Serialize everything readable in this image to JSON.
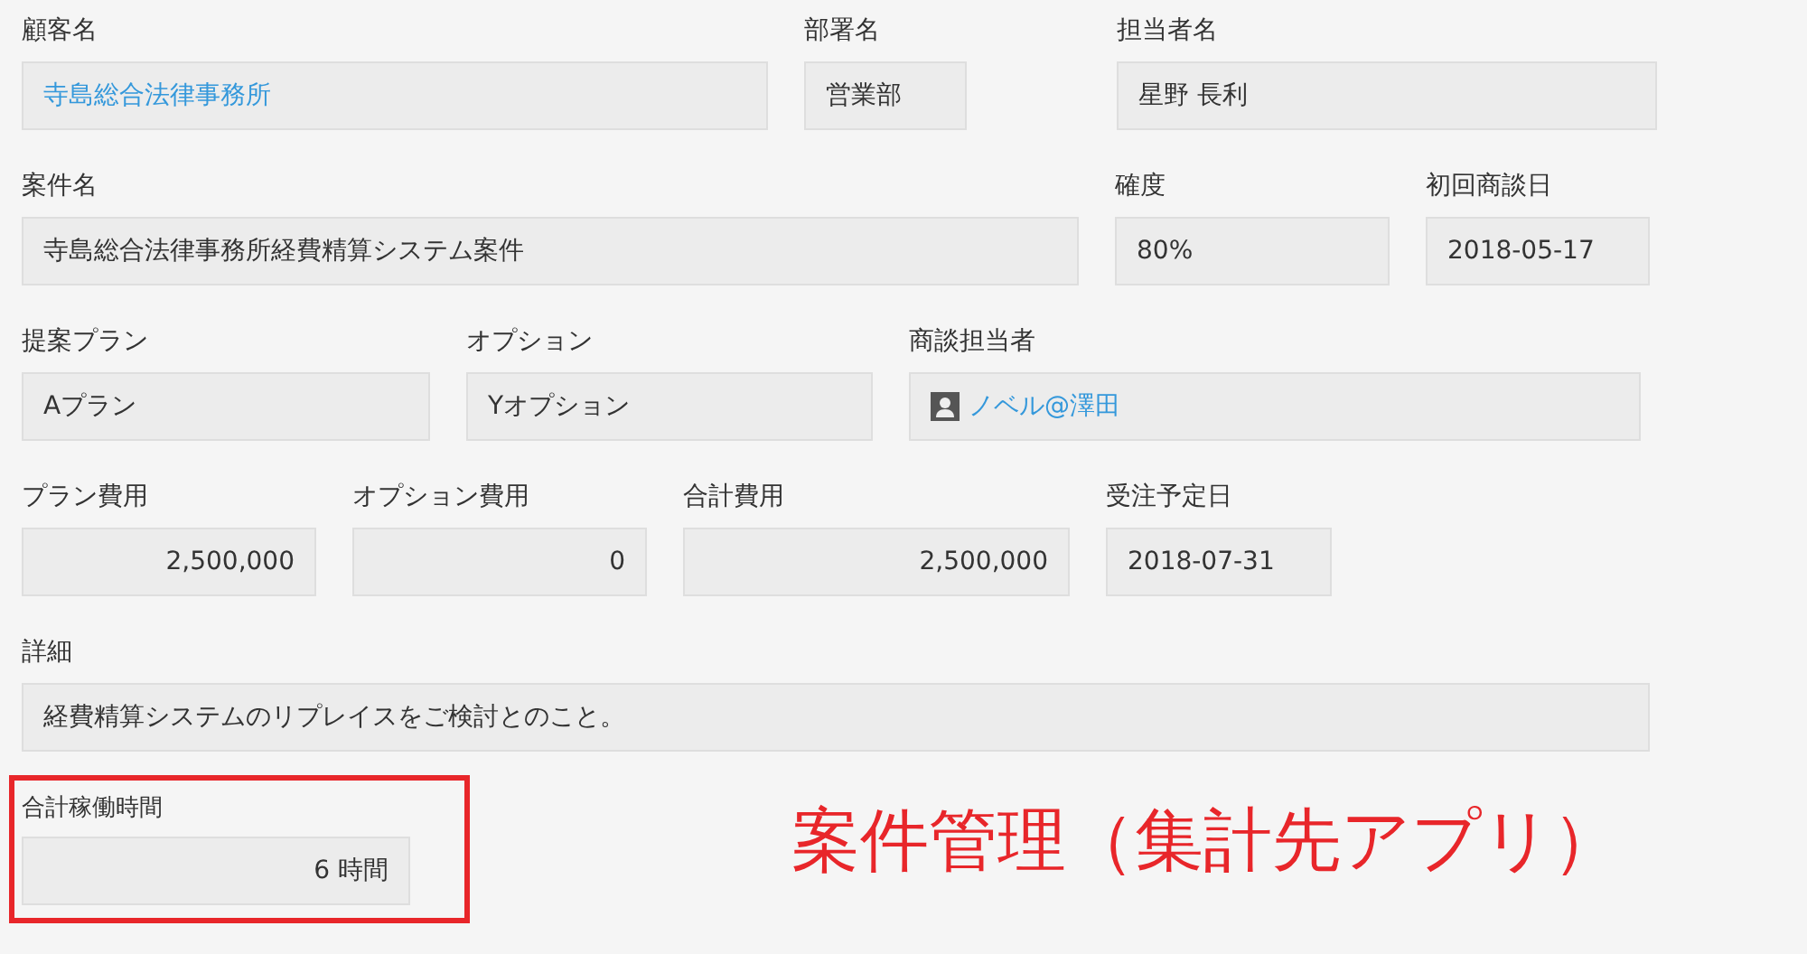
{
  "rows": [
    {
      "fields": [
        {
          "label": "顧客名",
          "value": "寺島総合法律事務所",
          "kind": "link"
        },
        {
          "label": "部署名",
          "value": "営業部",
          "kind": "text"
        },
        {
          "label": "担当者名",
          "value": "星野 長利",
          "kind": "text"
        }
      ]
    },
    {
      "fields": [
        {
          "label": "案件名",
          "value": "寺島総合法律事務所経費精算システム案件",
          "kind": "text"
        },
        {
          "label": "確度",
          "value": "80%",
          "kind": "text"
        },
        {
          "label": "初回商談日",
          "value": "2018-05-17",
          "kind": "text"
        }
      ]
    },
    {
      "fields": [
        {
          "label": "提案プラン",
          "value": "Aプラン",
          "kind": "text"
        },
        {
          "label": "オプション",
          "value": "Yオプション",
          "kind": "text"
        },
        {
          "label": "商談担当者",
          "value": "ノベル@澤田",
          "kind": "user"
        }
      ]
    },
    {
      "fields": [
        {
          "label": "プラン費用",
          "value": "2,500,000",
          "kind": "number"
        },
        {
          "label": "オプション費用",
          "value": "0",
          "kind": "number"
        },
        {
          "label": "合計費用",
          "value": "2,500,000",
          "kind": "number"
        },
        {
          "label": "受注予定日",
          "value": "2018-07-31",
          "kind": "text"
        }
      ]
    },
    {
      "fields": [
        {
          "label": "詳細",
          "value": "経費精算システムのリプレイスをご検討とのこと。",
          "kind": "text"
        }
      ]
    }
  ],
  "highlighted_field": {
    "label": "合計稼働時間",
    "value": "6 時間",
    "kind": "number"
  },
  "annotation": "案件管理（集計先アプリ）"
}
